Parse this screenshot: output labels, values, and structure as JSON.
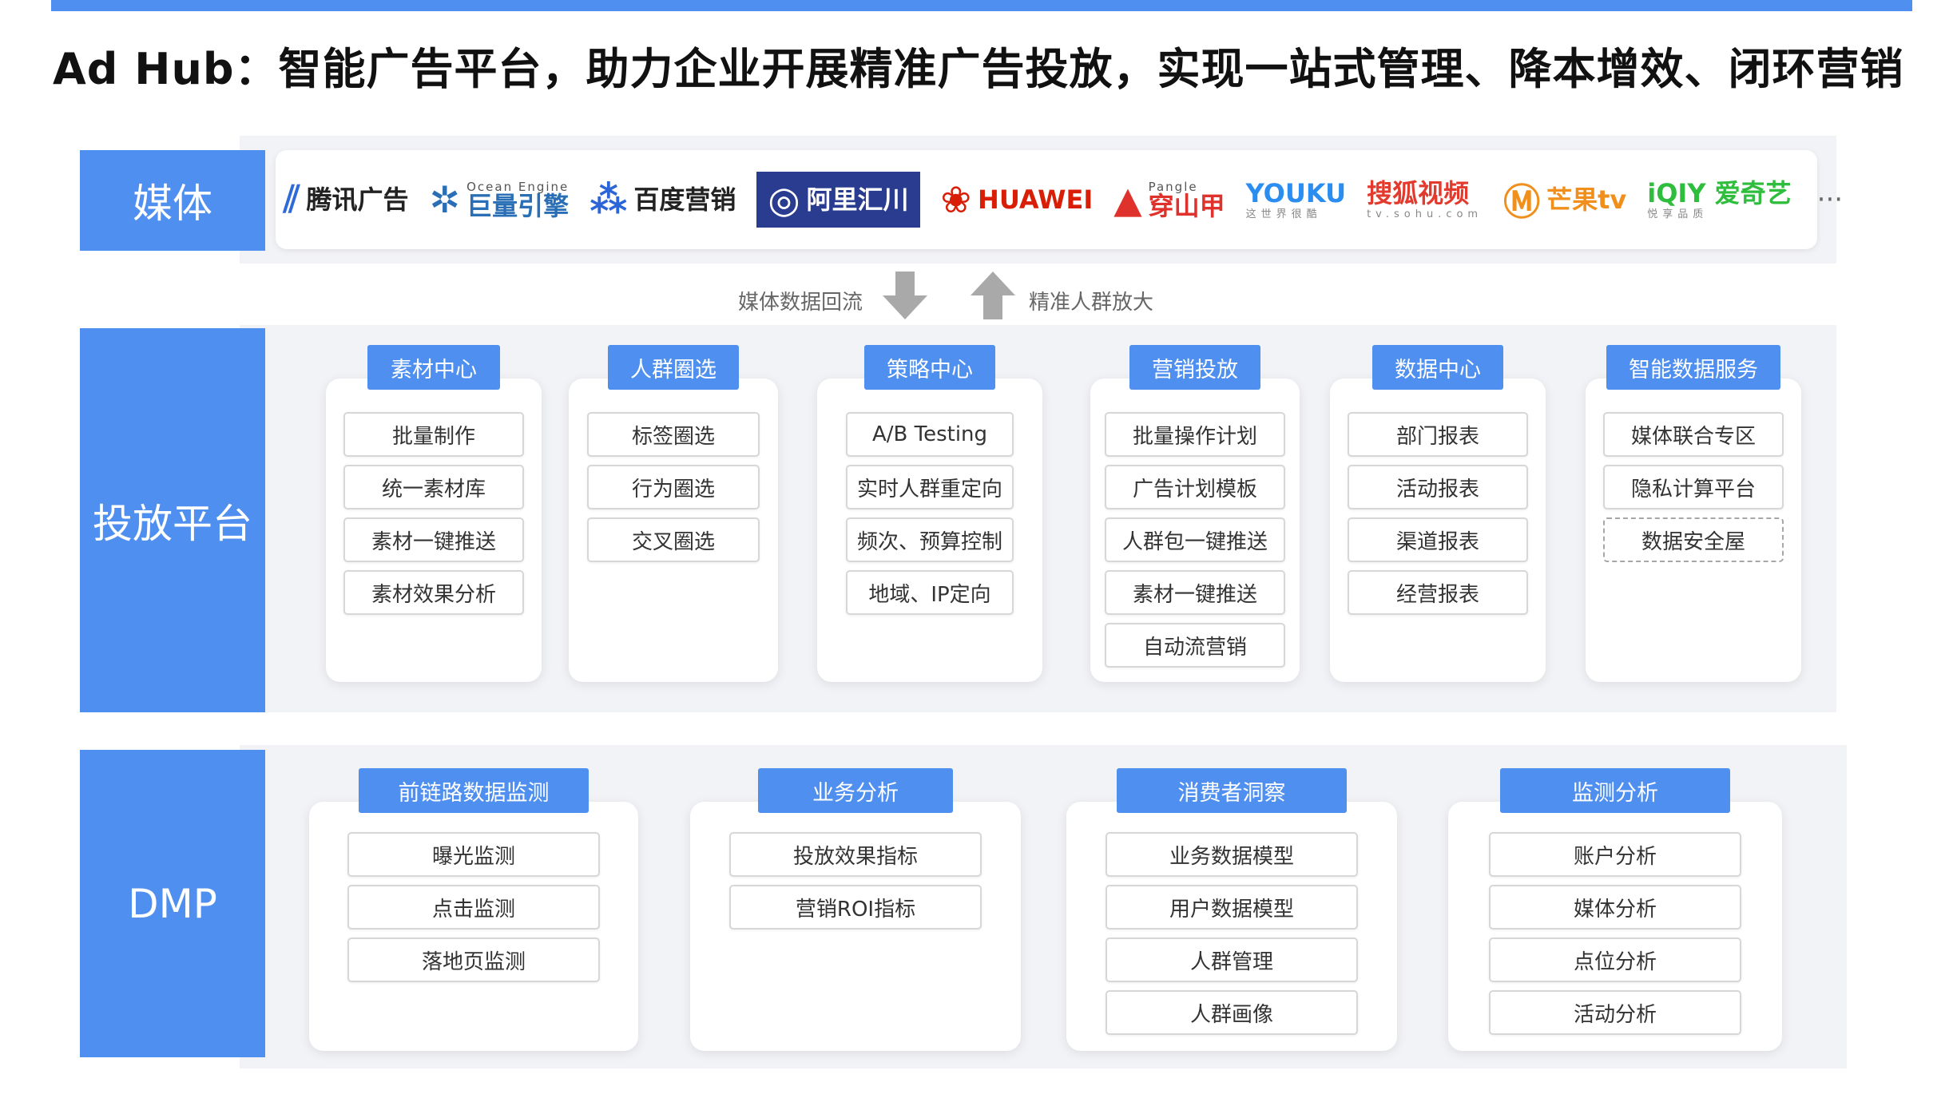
{
  "page": {
    "title": "Ad Hub：智能广告平台，助力企业开展精准广告投放，实现一站式管理、降本增效、闭环营销",
    "accent_color": "#4f8fef"
  },
  "media": {
    "label": "媒体",
    "logos": [
      {
        "glyph": "⫽",
        "name": "腾讯广告",
        "color": "#2f6bd8",
        "icon": "tencent-ads-logo"
      },
      {
        "glyph": "✲",
        "name": "巨量引擎",
        "sub": "Ocean Engine",
        "color": "#2a6fb5",
        "icon": "ocean-engine-logo"
      },
      {
        "glyph": "⁂",
        "name": "百度营销",
        "color": "#2c65d8",
        "icon": "baidu-marketing-logo"
      },
      {
        "glyph": "◎",
        "name": "阿里汇川",
        "color": "#ffffff",
        "bg": "#2a3c8f",
        "icon": "ali-huichuan-logo"
      },
      {
        "glyph": "❀",
        "name": "HUAWEI",
        "color": "#d81e06",
        "icon": "huawei-logo"
      },
      {
        "glyph": "▲",
        "name": "穿山甲",
        "sub": "Pangle",
        "color": "#e0322c",
        "icon": "pangle-logo"
      },
      {
        "glyph": "",
        "name": "YOUKU",
        "mini": "这世界很酷",
        "color": "#2b8df0",
        "icon": "youku-logo"
      },
      {
        "glyph": "",
        "name": "搜狐视频",
        "mini": "tv.sohu.com",
        "color": "#e33a2e",
        "icon": "sohu-video-logo"
      },
      {
        "glyph": "Ⓜ",
        "name": "芒果tv",
        "color": "#f08f1c",
        "icon": "mgtv-logo"
      },
      {
        "glyph": "",
        "name": "iQIY 爱奇艺",
        "mini": "悦享品质",
        "color": "#2ebd3c",
        "icon": "iqiyi-logo"
      }
    ],
    "more": "···"
  },
  "flow": {
    "down_label": "媒体数据回流",
    "up_label": "精准人群放大"
  },
  "platform": {
    "label": "投放平台",
    "modules": [
      {
        "title": "素材中心",
        "items": [
          "批量制作",
          "统一素材库",
          "素材一键推送",
          "素材效果分析"
        ]
      },
      {
        "title": "人群圈选",
        "items": [
          "标签圈选",
          "行为圈选",
          "交叉圈选"
        ]
      },
      {
        "title": "策略中心",
        "items": [
          "A/B Testing",
          "实时人群重定向",
          "频次、预算控制",
          "地域、IP定向"
        ]
      },
      {
        "title": "营销投放",
        "items": [
          "批量操作计划",
          "广告计划模板",
          "人群包一键推送",
          "素材一键推送",
          "自动流营销"
        ]
      },
      {
        "title": "数据中心",
        "items": [
          "部门报表",
          "活动报表",
          "渠道报表",
          "经营报表"
        ]
      },
      {
        "title": "智能数据服务",
        "items": [
          "媒体联合专区",
          "隐私计算平台",
          "数据安全屋"
        ]
      }
    ]
  },
  "dmp": {
    "label": "DMP",
    "modules": [
      {
        "title": "前链路数据监测",
        "items": [
          "曝光监测",
          "点击监测",
          "落地页监测"
        ]
      },
      {
        "title": "业务分析",
        "items": [
          "投放效果指标",
          "营销ROI指标"
        ]
      },
      {
        "title": "消费者洞察",
        "items": [
          "业务数据模型",
          "用户数据模型",
          "人群管理",
          "人群画像"
        ]
      },
      {
        "title": "监测分析",
        "items": [
          "账户分析",
          "媒体分析",
          "点位分析",
          "活动分析"
        ]
      }
    ]
  }
}
